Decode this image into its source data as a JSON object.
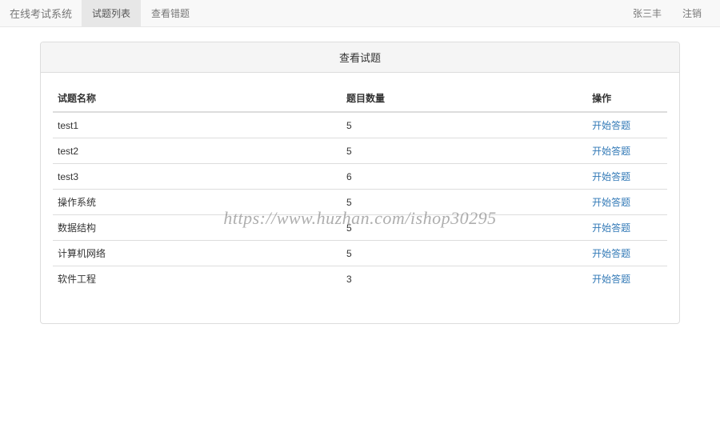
{
  "navbar": {
    "brand": "在线考试系统",
    "items": [
      {
        "label": "试题列表",
        "active": true
      },
      {
        "label": "查看错题",
        "active": false
      }
    ],
    "user": "张三丰",
    "logout": "注销"
  },
  "panel": {
    "title": "查看试题"
  },
  "table": {
    "headers": {
      "name": "试题名称",
      "count": "题目数量",
      "action": "操作"
    },
    "action_label": "开始答题",
    "rows": [
      {
        "name": "test1",
        "count": "5"
      },
      {
        "name": "test2",
        "count": "5"
      },
      {
        "name": "test3",
        "count": "6"
      },
      {
        "name": "操作系统",
        "count": "5"
      },
      {
        "name": "数据结构",
        "count": "5"
      },
      {
        "name": "计算机网络",
        "count": "5"
      },
      {
        "name": "软件工程",
        "count": "3"
      }
    ]
  },
  "watermark": "https://www.huzhan.com/ishop30295"
}
